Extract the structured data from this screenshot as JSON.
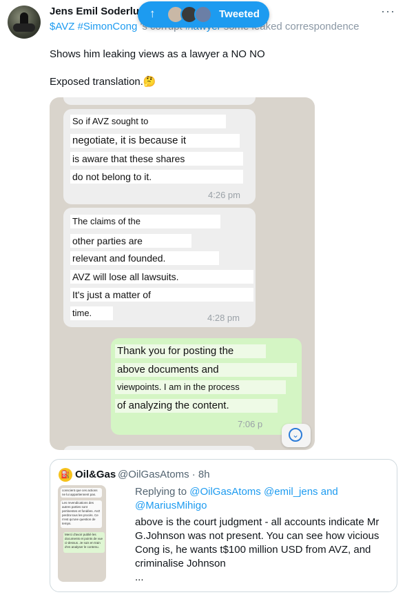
{
  "tweet": {
    "author_name": "Jens Emil Soderlund",
    "line1_tags": "$AVZ #SimonCong",
    "line1_rest": " 's corrupt ",
    "line1_tag2": "#lawyer",
    "line1_tail": " some leaked correspondence",
    "line2": "Shows him leaking views as a lawyer  a NO NO",
    "line3": "Exposed translation.",
    "emoji": "🤔"
  },
  "toast": {
    "arrow": "↑",
    "label": "Tweeted"
  },
  "chat": {
    "msg1": {
      "lines": [
        "So if AVZ sought to",
        "negotiate, it is because it",
        "is aware that these shares",
        "do not belong to it."
      ],
      "time": "4:26 pm"
    },
    "msg2": {
      "lines": [
        "The claims of the",
        "other parties are",
        "relevant and founded.",
        "AVZ will lose all lawsuits.",
        "It's just a matter of",
        "time."
      ],
      "time": "4:28 pm"
    },
    "msg3": {
      "lines": [
        "Thank you for posting the",
        "above documents and",
        "viewpoints. I am in the process",
        "of analyzing the content."
      ],
      "time": "7:06 p"
    }
  },
  "quoted": {
    "avatar_text": "⛽",
    "name": "Oil&Gas",
    "handle": "@OilGasAtoms · 8h",
    "replying_prefix": "Replying to ",
    "replying_to": "@OilGasAtoms @emil_jens and",
    "replying_to2": "@MariusMihigo",
    "lines": [
      "above is the court judgment - all accounts indicate Mr",
      "G.Johnson was not present. You can see how vicious",
      "Cong is, he wants t$100 million USD from AVZ, and",
      "criminalise Johnson",
      "..."
    ],
    "thumb": {
      "b1": "conscient que ces actions ne lui appartiennent pas.",
      "b2": "Les revendications des autres parties sont pertinentes et fondées. AVZ perdra tous les procès. Ce n'est qu'une question de temps.",
      "b3": "Merci d'avoir publié les documents et points de vue ci-dessus. Je suis en train d'en analyser le contenu."
    }
  }
}
